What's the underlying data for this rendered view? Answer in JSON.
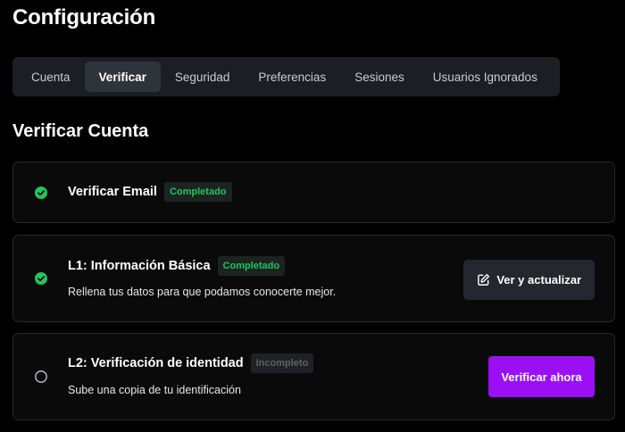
{
  "page": {
    "title": "Configuración"
  },
  "tabs": [
    {
      "label": "Cuenta"
    },
    {
      "label": "Verificar",
      "active": true
    },
    {
      "label": "Seguridad"
    },
    {
      "label": "Preferencias"
    },
    {
      "label": "Sesiones"
    },
    {
      "label": "Usuarios Ignorados"
    }
  ],
  "section": {
    "title": "Verificar Cuenta"
  },
  "steps": [
    {
      "title": "Verificar Email",
      "status": "Completado",
      "status_icon": "check-circle-icon"
    },
    {
      "title": "L1: Información Básica",
      "status": "Completado",
      "status_icon": "check-circle-icon",
      "description": "Rellena tus datos para que podamos conocerte mejor.",
      "action_label": "Ver y actualizar",
      "action_icon": "edit-icon"
    },
    {
      "title": "L2: Verificación de identidad",
      "status": "Incompleto",
      "status_icon": "empty-circle-icon",
      "description": "Sube una copia de tu identificación",
      "action_label": "Verificar ahora"
    }
  ],
  "colors": {
    "background": "#000000",
    "success": "#22c55e",
    "primary": "#9b0ff5",
    "tabs_background": "#1b1e23",
    "card_border": "#26292e"
  }
}
